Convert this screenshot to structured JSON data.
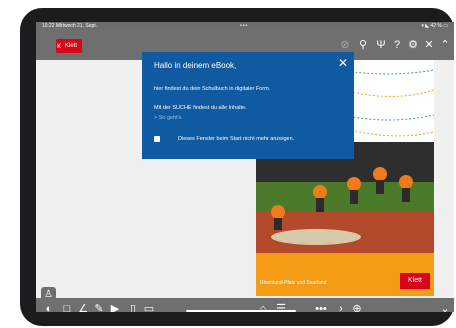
{
  "status": {
    "time_date": "10:22  Mittwoch 21. Sept.",
    "center": "•••",
    "right": "▾ ◣ 42 % ▭"
  },
  "logo": {
    "mark": "ᴋ",
    "label": "Klett"
  },
  "toolbar": {
    "icons": [
      "lock-icon",
      "search-icon",
      "marker-icon",
      "help-icon",
      "settings-icon",
      "close-icon",
      "collapse-icon"
    ],
    "search": "⚲",
    "marker": "Ψ",
    "help": "?",
    "settings": "⚙",
    "close": "✕",
    "collapse": "⌃",
    "lock": "⊘"
  },
  "popup": {
    "title": "Hallo in deinem eBook,",
    "line1": "hier findest du dein Schulbuch in digitaler Form.",
    "search_text": "Mit der SUCHE findest du alle Inhalte.",
    "link": "> So geht's",
    "checkbox_label": "Dieses Fenster beim Start nicht mehr anzeigen.",
    "close": "✕"
  },
  "cover": {
    "bottom_text": "Rheinland-Pfalz und Saarland",
    "logo_text": "Klett"
  },
  "sidebar": {
    "person": "♙"
  },
  "bottombar": {
    "toggle": "◐",
    "tools": [
      "□",
      "∠",
      "✎",
      "▶",
      "▯",
      "▭"
    ],
    "home": "⌂",
    "list": "☰",
    "dots": "•••",
    "next": "›",
    "zoom": "⊕",
    "more": "⌄"
  },
  "colors": {
    "toolbar_gray": "#6f6f6f",
    "popup_blue": "#0f5aa1",
    "klett_red": "#d9041c",
    "cover_orange": "#f59c16"
  }
}
